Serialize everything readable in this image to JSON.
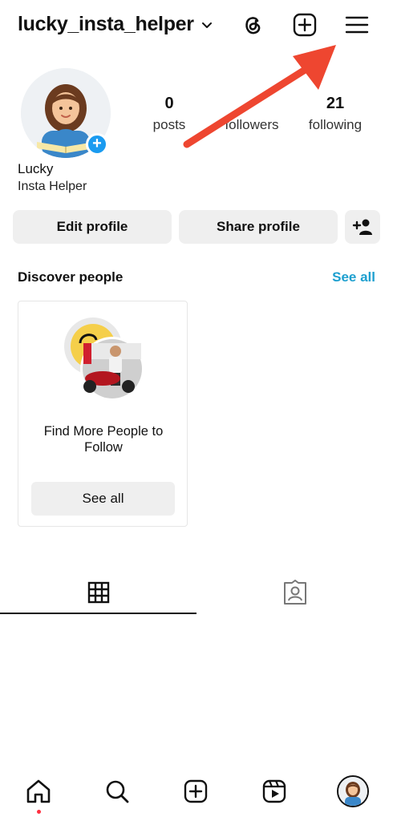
{
  "header": {
    "username": "lucky_insta_helper",
    "icons": [
      "chevron-down-icon",
      "threads-icon",
      "create-icon",
      "menu-icon"
    ]
  },
  "profile": {
    "name": "Lucky",
    "bio": "Insta Helper",
    "stats": {
      "posts": {
        "value": "0",
        "label": "posts"
      },
      "followers": {
        "value": "",
        "label": "followers"
      },
      "following": {
        "value": "21",
        "label": "following"
      }
    }
  },
  "actions": {
    "edit_profile": "Edit profile",
    "share_profile": "Share profile"
  },
  "discover": {
    "title": "Discover people",
    "see_all": "See all",
    "card": {
      "text": "Find More People to Follow",
      "button": "See all"
    }
  },
  "tabs": [
    "grid-icon",
    "tagged-icon"
  ],
  "bottom_nav": [
    "home-icon",
    "search-icon",
    "create-icon",
    "reels-icon",
    "profile-avatar"
  ],
  "colors": {
    "accent_blue": "#1d9fcf",
    "annotation_arrow": "#ee4630",
    "button_bg": "#efefef",
    "notification_dot": "#ff3040"
  }
}
